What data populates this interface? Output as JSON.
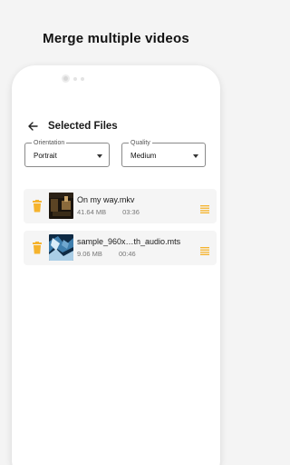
{
  "headline": "Merge multiple videos",
  "screen": {
    "title": "Selected Files",
    "orientation": {
      "label": "Orientation",
      "value": "Portrait"
    },
    "quality": {
      "label": "Quality",
      "value": "Medium"
    },
    "files": [
      {
        "name": "On my way.mkv",
        "size": "41.64 MB",
        "duration": "03:36"
      },
      {
        "name": "sample_960x…th_audio.mts",
        "size": "9.06 MB",
        "duration": "00:46"
      }
    ]
  },
  "colors": {
    "accent": "#f5b32d",
    "card": "#f5f5f5",
    "background": "#f4f4f4"
  }
}
